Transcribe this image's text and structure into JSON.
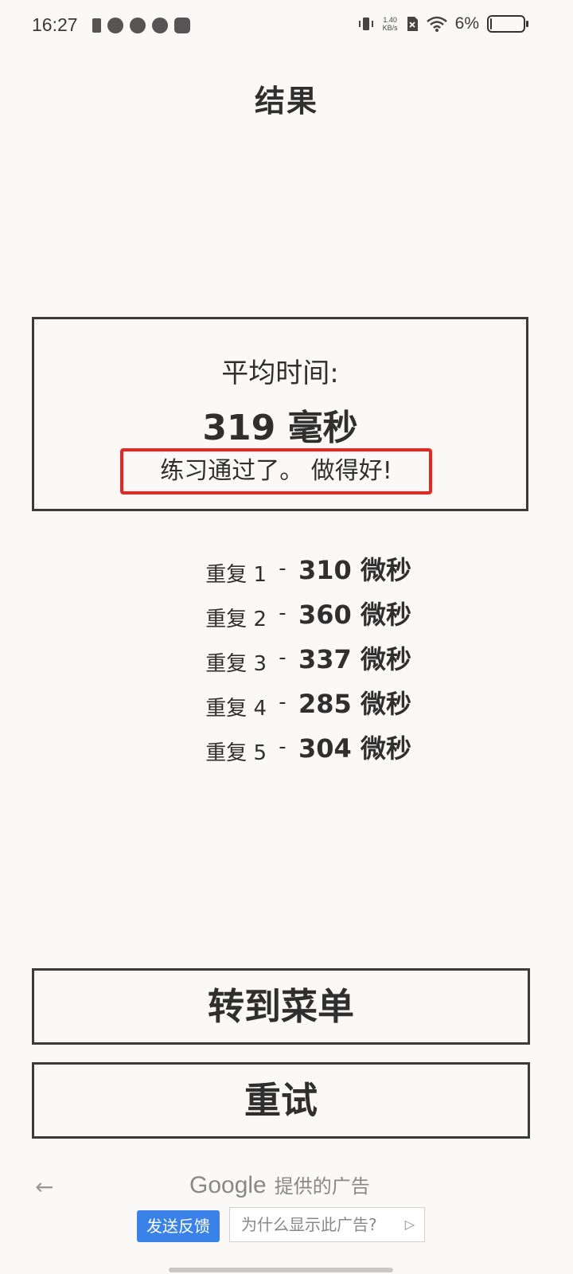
{
  "status_bar": {
    "time": "16:27",
    "speed_value": "1.40",
    "speed_unit": "KB/s",
    "battery_percent": "6%",
    "battery_level": 0.06,
    "icons": [
      "battery-small-icon",
      "app-icon",
      "play-icon",
      "app-q-icon",
      "app-du-icon",
      "vibrate-icon",
      "no-sim-icon",
      "wifi-icon",
      "battery-icon"
    ]
  },
  "page": {
    "title": "结果"
  },
  "result": {
    "avg_label": "平均时间:",
    "avg_value": "319 毫秒",
    "message": "练习通过了。 做得好!"
  },
  "reps": [
    {
      "label": "重复 1",
      "dash": "-",
      "value": "310 微秒"
    },
    {
      "label": "重复 2",
      "dash": "-",
      "value": "360 微秒"
    },
    {
      "label": "重复 3",
      "dash": "-",
      "value": "337 微秒"
    },
    {
      "label": "重复 4",
      "dash": "-",
      "value": "285 微秒"
    },
    {
      "label": "重复 5",
      "dash": "-",
      "value": "304 微秒"
    }
  ],
  "buttons": {
    "menu": "转到菜单",
    "retry": "重试"
  },
  "ad": {
    "back_arrow": "←",
    "google": "Google",
    "provided_by": "提供的广告",
    "feedback": "发送反馈",
    "why": "为什么显示此广告?",
    "why_icon": "▷"
  },
  "colors": {
    "background": "#faf9f7",
    "text": "#2f2f2f",
    "highlight_border": "#e8261f",
    "feedback_button": "#3b82e8"
  }
}
